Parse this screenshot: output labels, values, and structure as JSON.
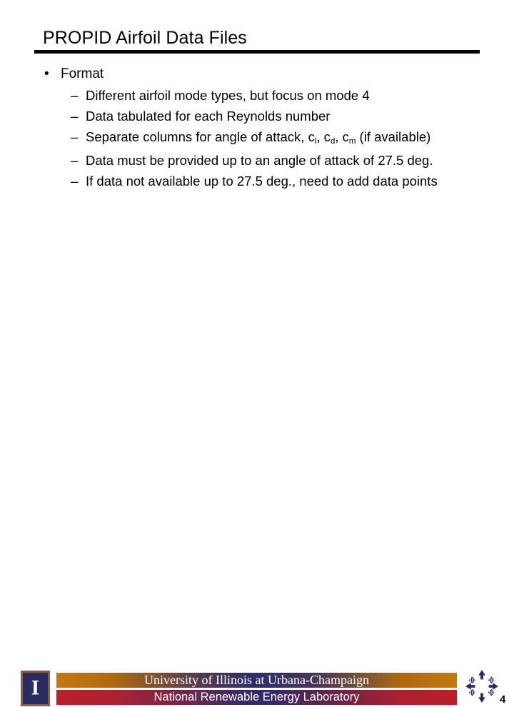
{
  "slide": {
    "title": "PROPID Airfoil Data Files",
    "page_number": "4",
    "background_color": "#ffffff",
    "title_rule_color": "#000000"
  },
  "body": {
    "bullets": [
      {
        "level": 1,
        "marker": "•",
        "text": "Format"
      },
      {
        "level": 2,
        "marker": "–",
        "text": "Different airfoil mode types, but focus on mode 4"
      },
      {
        "level": 2,
        "marker": "–",
        "text": "Data tabulated for each Reynolds number"
      },
      {
        "level": 2,
        "marker": "–",
        "text_parts": [
          {
            "t": "Separate columns for angle of attack, c"
          },
          {
            "sub": "l"
          },
          {
            "t": ", c"
          },
          {
            "sub": "d"
          },
          {
            "t": ", c"
          },
          {
            "sub": "m"
          },
          {
            "t": " (if available)"
          }
        ]
      },
      {
        "level": 2,
        "marker": "–",
        "text": "Data must be provided up to an angle of attack of 27.5 deg."
      },
      {
        "level": 2,
        "marker": "–",
        "text": "If data not available up to 27.5 deg., need to add data points"
      }
    ]
  },
  "footer": {
    "block_i_letter": "I",
    "block_i_border_color": "#8a5a44",
    "block_i_field_color": "#2b2b63",
    "banner_line1": "University of Illinois at Urbana-Champaign",
    "banner_line2": "National Renewable Energy Laboratory",
    "banner_gradient_top": [
      "#c4780f",
      "#2e2c6e",
      "#c4780f"
    ],
    "banner_gradient_bottom": [
      "#bb1f2a",
      "#2e2c6e",
      "#bb1f2a"
    ],
    "nrel_logo_color": "#2b2b63"
  }
}
